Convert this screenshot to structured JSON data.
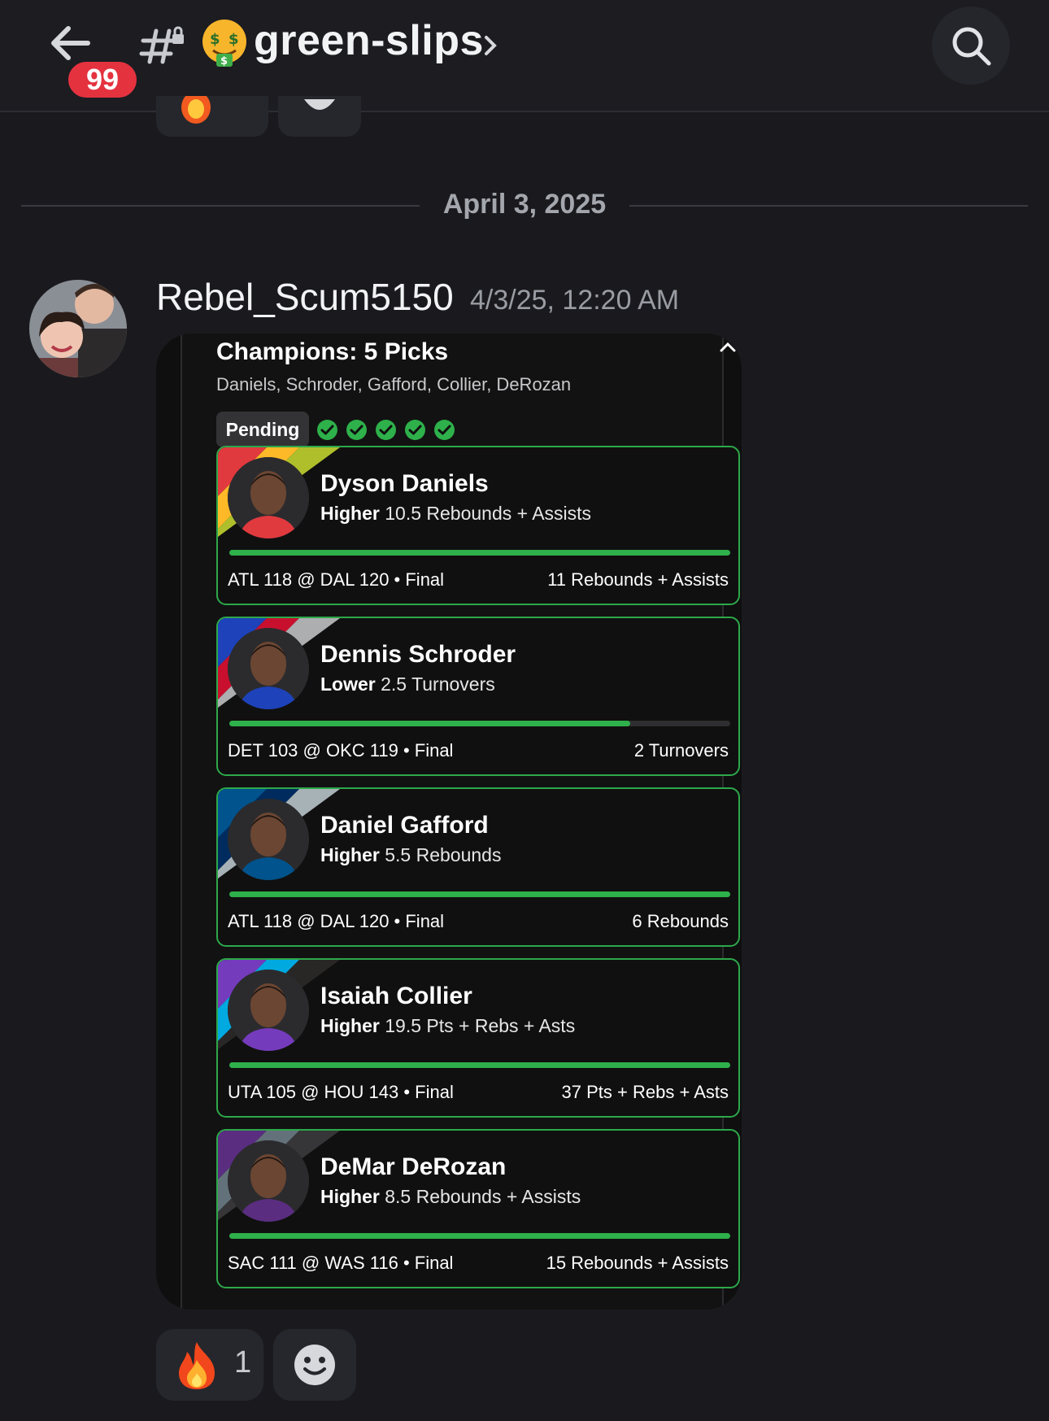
{
  "header": {
    "unread_count": "99",
    "channel_name": "green-slips",
    "channel_emoji": "money-mouth-face-icon"
  },
  "date_divider": "April 3, 2025",
  "message": {
    "author": "Rebel_Scum5150",
    "timestamp": "4/3/25, 12:20 AM"
  },
  "slip": {
    "title": "Champions: 5 Picks",
    "subtitle": "Daniels, Schroder, Gafford, Collier, DeRozan",
    "status": "Pending",
    "check_count": 5,
    "accent_color": "#2eb04a",
    "picks": [
      {
        "name": "Dyson Daniels",
        "direction": "Higher",
        "line": "10.5 Rebounds + Assists",
        "game": "ATL 118 @ DAL 120 • Final",
        "result": "11 Rebounds + Assists",
        "progress": 1.0,
        "team_colors": [
          "#e03a3e",
          "#fdb927",
          "#c1d32f"
        ]
      },
      {
        "name": "Dennis Schroder",
        "direction": "Lower",
        "line": "2.5 Turnovers",
        "game": "DET 103 @ OKC 119 • Final",
        "result": "2 Turnovers",
        "progress": 0.8,
        "team_colors": [
          "#1d42ba",
          "#c8102e",
          "#bec0c2"
        ]
      },
      {
        "name": "Daniel Gafford",
        "direction": "Higher",
        "line": "5.5 Rebounds",
        "game": "ATL 118 @ DAL 120 • Final",
        "result": "6 Rebounds",
        "progress": 1.0,
        "team_colors": [
          "#00538c",
          "#002b5e",
          "#b8c4ca"
        ]
      },
      {
        "name": "Isaiah Collier",
        "direction": "Higher",
        "line": "19.5 Pts + Rebs + Asts",
        "game": "UTA 105 @ HOU 143 • Final",
        "result": "37 Pts + Rebs + Asts",
        "progress": 1.0,
        "team_colors": [
          "#753bbd",
          "#00a9e0",
          "#2c2a29"
        ]
      },
      {
        "name": "DeMar DeRozan",
        "direction": "Higher",
        "line": "8.5 Rebounds + Assists",
        "game": "SAC 111 @ WAS 116 • Final",
        "result": "15 Rebounds + Assists",
        "progress": 1.0,
        "team_colors": [
          "#5a2d81",
          "#63727a",
          "#3b3b3d"
        ]
      }
    ]
  },
  "reactions": [
    {
      "emoji": "fire-icon",
      "count": "1"
    },
    {
      "emoji": "add-reaction-icon"
    }
  ]
}
